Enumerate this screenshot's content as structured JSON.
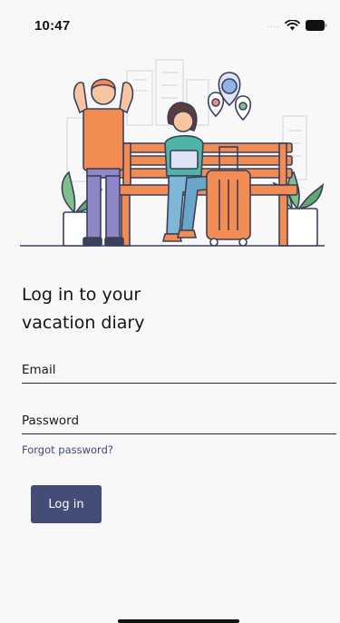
{
  "status_bar": {
    "time": "10:47",
    "signal": "....",
    "icons": [
      "wifi-icon",
      "battery-icon"
    ]
  },
  "illustration": {
    "subject": "two-travelers-with-bench-suitcase-plants-map-pins",
    "colors": {
      "outline": "#3a3f5c",
      "orange": "#f28c52",
      "purple": "#8f86c7",
      "teal": "#4fb3a5",
      "pink_pin": "#e78b8b",
      "blue_pin": "#8db4e6",
      "green_plant": "#7fbf8a",
      "city": "#d8d9df"
    }
  },
  "login": {
    "title_line1": "Log in to your",
    "title_line2": "vacation diary",
    "email_label": "Email",
    "password_label": "Password",
    "forgot_password": "Forgot password?",
    "login_button": "Log in"
  },
  "theme": {
    "primary": "#434d78",
    "link": "#3f4a74",
    "background": "#f8f8f9"
  }
}
